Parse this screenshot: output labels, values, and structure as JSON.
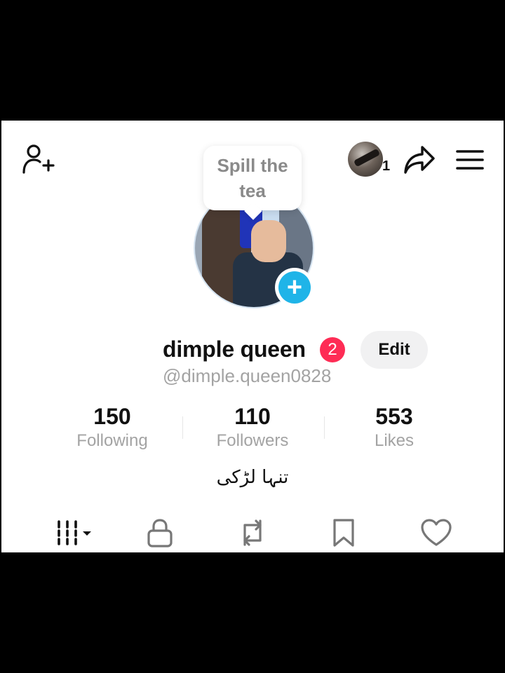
{
  "tooltip": {
    "text": "Spill the tea"
  },
  "header": {
    "notification_count": "1"
  },
  "profile": {
    "display_name": "dimple queen",
    "badge_count": "2",
    "edit_label": "Edit",
    "username": "@dimple.queen0828",
    "bio": "تنہا لڑکی"
  },
  "stats": [
    {
      "value": "150",
      "label": "Following"
    },
    {
      "value": "110",
      "label": "Followers"
    },
    {
      "value": "553",
      "label": "Likes"
    }
  ],
  "colors": {
    "accent": "#fe2c55",
    "add_story": "#1fb4e8"
  },
  "icons": [
    "add-friend-icon",
    "share-icon",
    "menu-icon",
    "grid-icon",
    "lock-icon",
    "repost-icon",
    "bookmark-icon",
    "heart-icon"
  ]
}
